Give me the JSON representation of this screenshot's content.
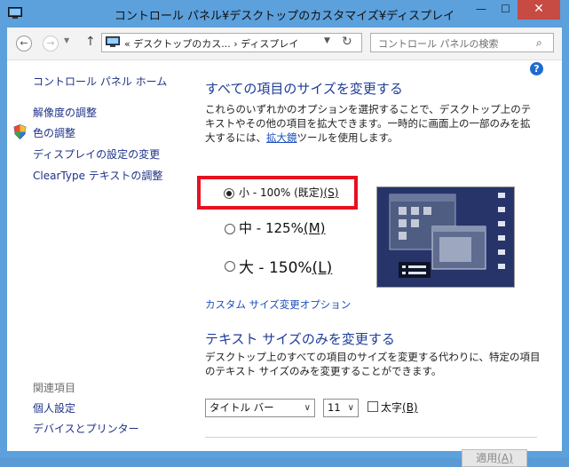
{
  "window": {
    "title": "コントロール パネル¥デスクトップのカスタマイズ¥ディスプレイ",
    "minimize": "—",
    "maximize": "☐",
    "close": "✕"
  },
  "nav": {
    "back": "←",
    "forward": "→",
    "history": "▼",
    "up": "↑",
    "address_prefix": "«",
    "address_segment1": "デスクトップのカス...",
    "address_sep": "›",
    "address_segment2": "ディスプレイ",
    "address_drop": "▼",
    "refresh": "↻",
    "search_placeholder": "コントロール パネルの検索",
    "search_icon": "⌕"
  },
  "help": {
    "label": "?"
  },
  "sidebar": {
    "home": "コントロール パネル ホーム",
    "links": [
      "解像度の調整",
      "色の調整",
      "ディスプレイの設定の変更",
      "ClearType テキストの調整"
    ],
    "related_heading": "関連項目",
    "related": [
      "個人設定",
      "デバイスとプリンター"
    ]
  },
  "main": {
    "heading1": "すべての項目のサイズを変更する",
    "desc1": "これらのいずれかのオプションを選択することで、デスクトップ上のテキストやその他の項目を拡大できます。一時的に画面上の一部のみを拡大するには、",
    "desc1_link": "拡大鏡",
    "desc1_tail": "ツールを使用します。",
    "options": [
      {
        "label": "小 - 100% (既定)",
        "key": "(S)",
        "selected": true
      },
      {
        "label": "中 - 125%",
        "key": "(M)",
        "selected": false
      },
      {
        "label": "大 - 150%",
        "key": "(L)",
        "selected": false
      }
    ],
    "custom_link": "カスタム サイズ変更オプション",
    "heading2": "テキスト サイズのみを変更する",
    "desc2": "デスクトップ上のすべての項目のサイズを変更する代わりに、特定の項目のテキスト サイズのみを変更することができます。",
    "item_select": "タイトル バー",
    "size_select": "11",
    "select_arrow": "∨",
    "bold_label": "太字",
    "bold_key": "(B)",
    "apply_label": "適用",
    "apply_key": "(A)"
  },
  "colors": {
    "frame": "#5ca0dc",
    "close": "#c74a43",
    "link": "#1e3287",
    "heading": "#1f3d99",
    "highlight": "#e8101f",
    "preview_bg": "#26346a"
  }
}
